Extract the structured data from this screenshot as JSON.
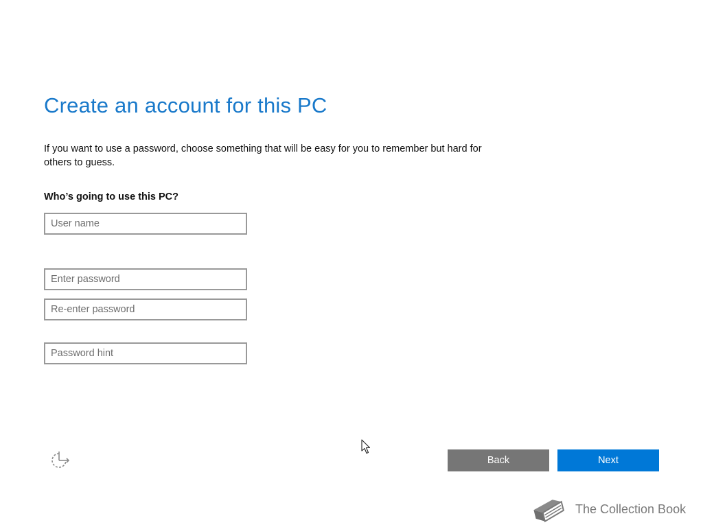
{
  "page": {
    "title": "Create an account for this PC",
    "description": "If you want to use a password, choose something that will be easy for you to remember but hard for others to guess.",
    "question": "Who’s going to use this PC?"
  },
  "form": {
    "username": {
      "value": "",
      "placeholder": "User name"
    },
    "password": {
      "value": "",
      "placeholder": "Enter password"
    },
    "reenter_password": {
      "value": "",
      "placeholder": "Re-enter password"
    },
    "hint": {
      "value": "",
      "placeholder": "Password hint"
    }
  },
  "footer": {
    "back_label": "Back",
    "next_label": "Next",
    "accessibility_icon": "ease-of-access-icon"
  },
  "watermark": {
    "text": "The Collection Book",
    "icon": "book-icon"
  },
  "colors": {
    "title": "#1979ca",
    "next_button": "#0078d7",
    "back_button": "#767676",
    "field_border": "#999999"
  }
}
